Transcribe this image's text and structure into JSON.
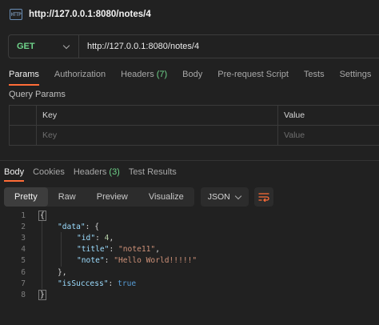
{
  "tab": {
    "title": "http://127.0.0.1:8080/notes/4",
    "icon": "http-file-icon",
    "icon_text": "HTTP"
  },
  "request": {
    "method": "GET",
    "url": "http://127.0.0.1:8080/notes/4",
    "method_color": "#6fd38a"
  },
  "request_tabs": [
    {
      "label": "Params",
      "active": true
    },
    {
      "label": "Authorization"
    },
    {
      "label": "Headers",
      "count": "(7)"
    },
    {
      "label": "Body"
    },
    {
      "label": "Pre-request Script"
    },
    {
      "label": "Tests"
    },
    {
      "label": "Settings"
    }
  ],
  "query_params": {
    "section_label": "Query Params",
    "headers": {
      "key": "Key",
      "value": "Value"
    },
    "placeholders": {
      "key": "Key",
      "value": "Value"
    }
  },
  "response_tabs": [
    {
      "label": "Body",
      "active": true
    },
    {
      "label": "Cookies"
    },
    {
      "label": "Headers",
      "count": "(3)"
    },
    {
      "label": "Test Results"
    }
  ],
  "view_modes": [
    "Pretty",
    "Raw",
    "Preview",
    "Visualize"
  ],
  "active_view": "Pretty",
  "format": "JSON",
  "code": {
    "line_numbers": [
      "1",
      "2",
      "3",
      "4",
      "5",
      "6",
      "7",
      "8"
    ],
    "lines": {
      "l1_open": "{",
      "l2_key": "\"data\"",
      "l2_rest": ": {",
      "l3_key": "\"id\"",
      "l3_colon": ": ",
      "l3_val": "4",
      "l3_comma": ",",
      "l4_key": "\"title\"",
      "l4_colon": ": ",
      "l4_val": "\"note11\"",
      "l4_comma": ",",
      "l5_key": "\"note\"",
      "l5_colon": ": ",
      "l5_val": "\"Hello World!!!!!\"",
      "l6_close": "},",
      "l7_key": "\"isSuccess\"",
      "l7_colon": ": ",
      "l7_val": "true",
      "l8_close": "}"
    }
  },
  "accent_color": "#ff6c37"
}
